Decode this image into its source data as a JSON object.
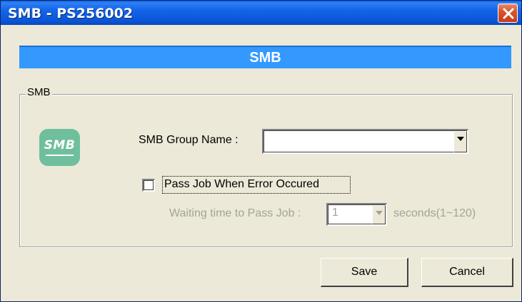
{
  "window": {
    "title": "SMB - PS256002"
  },
  "header": {
    "title": "SMB"
  },
  "group": {
    "legend": "SMB",
    "logo_text": "SMB"
  },
  "form": {
    "group_name_label": "SMB Group Name :",
    "group_name_value": "",
    "pass_job_label": "Pass Job When Error Occured",
    "pass_job_checked": false,
    "waiting_label": "Waiting time to Pass Job :",
    "waiting_value": "1",
    "waiting_unit": "seconds(1~120)"
  },
  "buttons": {
    "save_label": "Save",
    "cancel_label": "Cancel"
  },
  "colors": {
    "titlebar": "#0a55d6",
    "header_band": "#3399ff",
    "dialog_bg": "#ece9d8",
    "close_button": "#d9552d",
    "logo": "#6fbf9c",
    "disabled_text": "#a3a397"
  },
  "icons": {
    "close": "close-x-icon",
    "logo": "smb-logo-icon",
    "dropdown": "chevron-down-icon"
  }
}
